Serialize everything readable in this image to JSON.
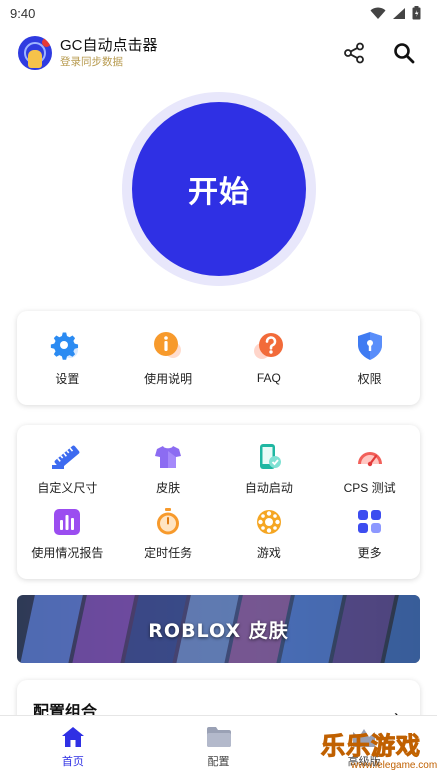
{
  "status_bar": {
    "time": "9:40"
  },
  "app_bar": {
    "title": "GC自动点击器",
    "subtitle": "登录同步数据"
  },
  "start_button": {
    "label": "开始"
  },
  "main_tools": [
    {
      "label": "设置",
      "icon": "gear-icon"
    },
    {
      "label": "使用说明",
      "icon": "info-icon"
    },
    {
      "label": "FAQ",
      "icon": "question-icon"
    },
    {
      "label": "权限",
      "icon": "shield-icon"
    }
  ],
  "feature_tools": [
    {
      "label": "自定义尺寸",
      "icon": "ruler-icon"
    },
    {
      "label": "皮肤",
      "icon": "shirt-icon"
    },
    {
      "label": "自动启动",
      "icon": "phone-auto-icon"
    },
    {
      "label": "CPS 测试",
      "icon": "speedometer-icon"
    },
    {
      "label": "使用情况报告",
      "icon": "bar-chart-icon"
    },
    {
      "label": "定时任务",
      "icon": "stopwatch-icon"
    },
    {
      "label": "游戏",
      "icon": "gamepad-icon"
    },
    {
      "label": "更多",
      "icon": "grid-icon"
    }
  ],
  "banner": {
    "label": "ROBLOX 皮肤"
  },
  "config_section": {
    "title": "配置组合"
  },
  "bottom_nav": [
    {
      "label": "首页",
      "icon": "home-icon",
      "active": true
    },
    {
      "label": "配置",
      "icon": "folder-icon",
      "active": false
    },
    {
      "label": "高级版",
      "icon": "crown-icon",
      "active": false
    }
  ],
  "watermark": {
    "text": "乐乐游戏",
    "url": "www.lelegame.com"
  },
  "colors": {
    "accent": "#2F30E4",
    "start_ring": "#E8E7FB"
  }
}
